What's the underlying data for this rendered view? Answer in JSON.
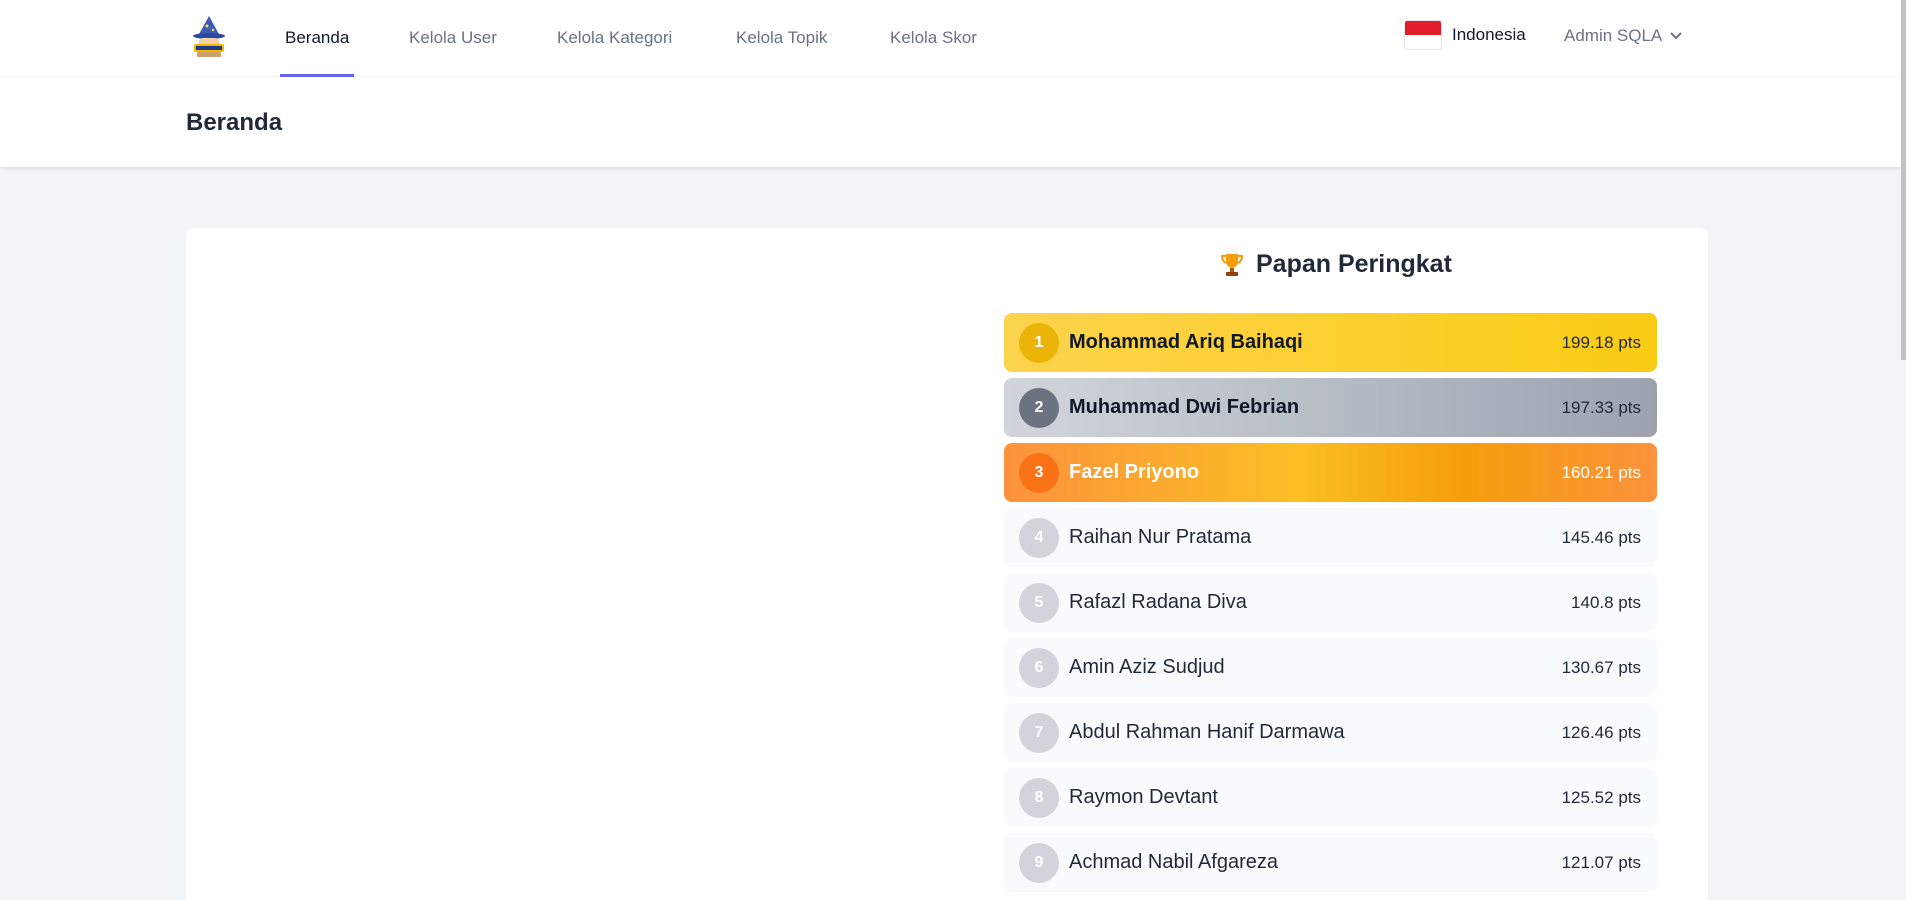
{
  "nav": {
    "links": [
      {
        "label": "Beranda"
      },
      {
        "label": "Kelola User"
      },
      {
        "label": "Kelola Kategori"
      },
      {
        "label": "Kelola Topik"
      },
      {
        "label": "Kelola Skor"
      }
    ],
    "active_index": 0,
    "language": "Indonesia",
    "user": "Admin SQLA",
    "logo_icon": "wizard-logo-icon",
    "flag_icon": "indonesia-flag-icon"
  },
  "header": {
    "title": "Beranda"
  },
  "leaderboard": {
    "title": "Papan Peringkat",
    "title_icon": "trophy-icon",
    "entries": [
      {
        "rank": "1",
        "name": "Mohammad Ariq Baihaqi",
        "points": "199.18 pts"
      },
      {
        "rank": "2",
        "name": "Muhammad Dwi Febrian",
        "points": "197.33 pts"
      },
      {
        "rank": "3",
        "name": "Fazel Priyono",
        "points": "160.21 pts"
      },
      {
        "rank": "4",
        "name": "Raihan Nur Pratama",
        "points": "145.46 pts"
      },
      {
        "rank": "5",
        "name": "Rafazl Radana Diva",
        "points": "140.8 pts"
      },
      {
        "rank": "6",
        "name": "Amin Aziz Sudjud",
        "points": "130.67 pts"
      },
      {
        "rank": "7",
        "name": "Abdul Rahman Hanif Darmawa",
        "points": "126.46 pts"
      },
      {
        "rank": "8",
        "name": "Raymon Devtant",
        "points": "125.52 pts"
      },
      {
        "rank": "9",
        "name": "Achmad Nabil Afgareza",
        "points": "121.07 pts"
      }
    ]
  },
  "colors": {
    "accent": "#6366f1",
    "gold": "#facc15",
    "silver": "#9ca3af",
    "bronze": "#f59e0b"
  }
}
